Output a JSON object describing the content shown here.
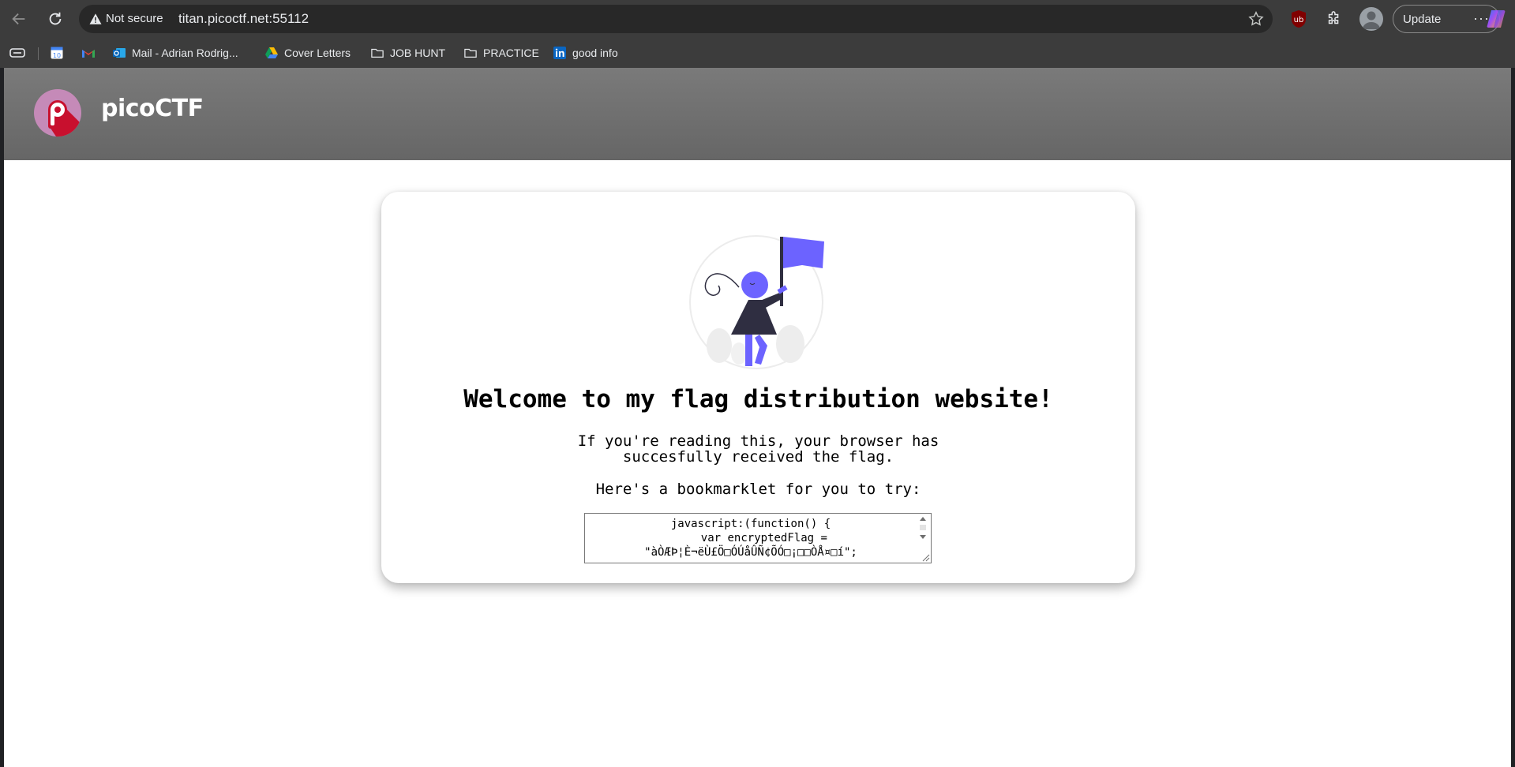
{
  "browser": {
    "security_label": "Not secure",
    "url": "titan.picoctf.net:55112",
    "update_label": "Update",
    "more_label": "···"
  },
  "bookmarks": [
    {
      "label": "",
      "icon": "calendar-icon"
    },
    {
      "label": "",
      "icon": "gmail-icon"
    },
    {
      "label": "Mail - Adrian Rodrig...",
      "icon": "outlook-icon"
    },
    {
      "label": "Cover Letters",
      "icon": "google-drive-icon"
    },
    {
      "label": "JOB HUNT",
      "icon": "folder-icon"
    },
    {
      "label": "PRACTICE",
      "icon": "folder-icon"
    },
    {
      "label": "good info",
      "icon": "linkedin-icon"
    }
  ],
  "calendar_day": "10",
  "site": {
    "logo_text": "picoCTF"
  },
  "card": {
    "heading": "Welcome to my flag distribution website!",
    "line1": "If you're reading this, your browser has",
    "line2": "succesfully received the flag.",
    "prompt": "Here's a bookmarklet for you to try:",
    "code": "javascript:(function() {\n    var encryptedFlag =\n\"àÒÆÞ¦È¬ëÙ£Ö□ÓÚåÛÑ¢ÕÓ□¡□□ÒÅ¤□í\";"
  },
  "colors": {
    "chrome": "#3c3c3c",
    "omnibox": "#282828",
    "header": "#707070",
    "accent_purple": "#6c63ff",
    "logo_red": "#c8102e",
    "logo_pink": "#c58ab8"
  }
}
